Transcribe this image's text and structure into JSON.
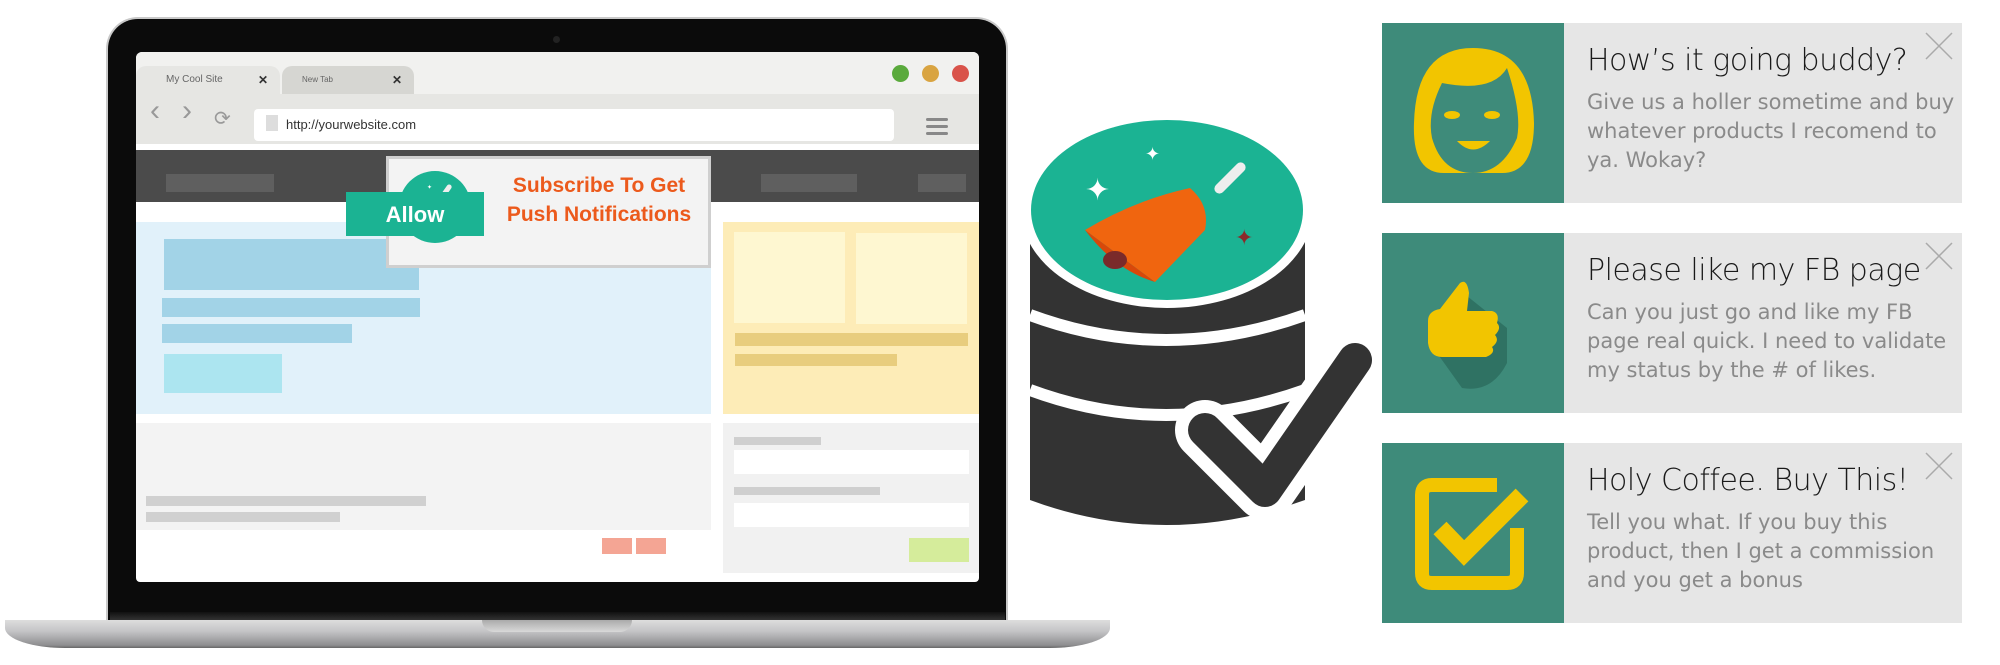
{
  "browser": {
    "tabs": [
      {
        "label": "My Cool Site",
        "close": "✕",
        "active": true
      },
      {
        "label": "New Tab",
        "close": "✕",
        "active": false
      }
    ],
    "window_controls": {
      "colors": [
        "#5aaa3c",
        "#d9a441",
        "#d9534a"
      ]
    },
    "url": "http://yourwebsite.com",
    "nav_icons": {
      "back": "‹",
      "forward": "›",
      "reload": "⟳"
    }
  },
  "popup": {
    "title_line1": "Subscribe To Get",
    "title_line2": "Push Notifications",
    "allow_label": "Allow",
    "accent": "#ec5a1c",
    "button_color": "#1bb393"
  },
  "illustration": {
    "icon": "database-bell-check-icon"
  },
  "notifications": [
    {
      "icon": "woman-face-icon",
      "title": "How’s it going buddy?",
      "body": "Give us a holler sometime and buy whatever products I recomend to ya. Wokay?"
    },
    {
      "icon": "thumbs-up-icon",
      "title": "Please like my FB page",
      "body": "Can you just go and like my FB page real quick. I need to validate my status by the # of likes."
    },
    {
      "icon": "checkbox-check-icon",
      "title": "Holy Coffee. Buy This!",
      "body": "Tell you what. If you buy this product, then I get a commission and you get a bonus"
    }
  ],
  "colors": {
    "notification_icon_bg": "#3e8b7a",
    "icon_yellow": "#f2c500",
    "teal": "#1bb393",
    "dark": "#333333"
  }
}
